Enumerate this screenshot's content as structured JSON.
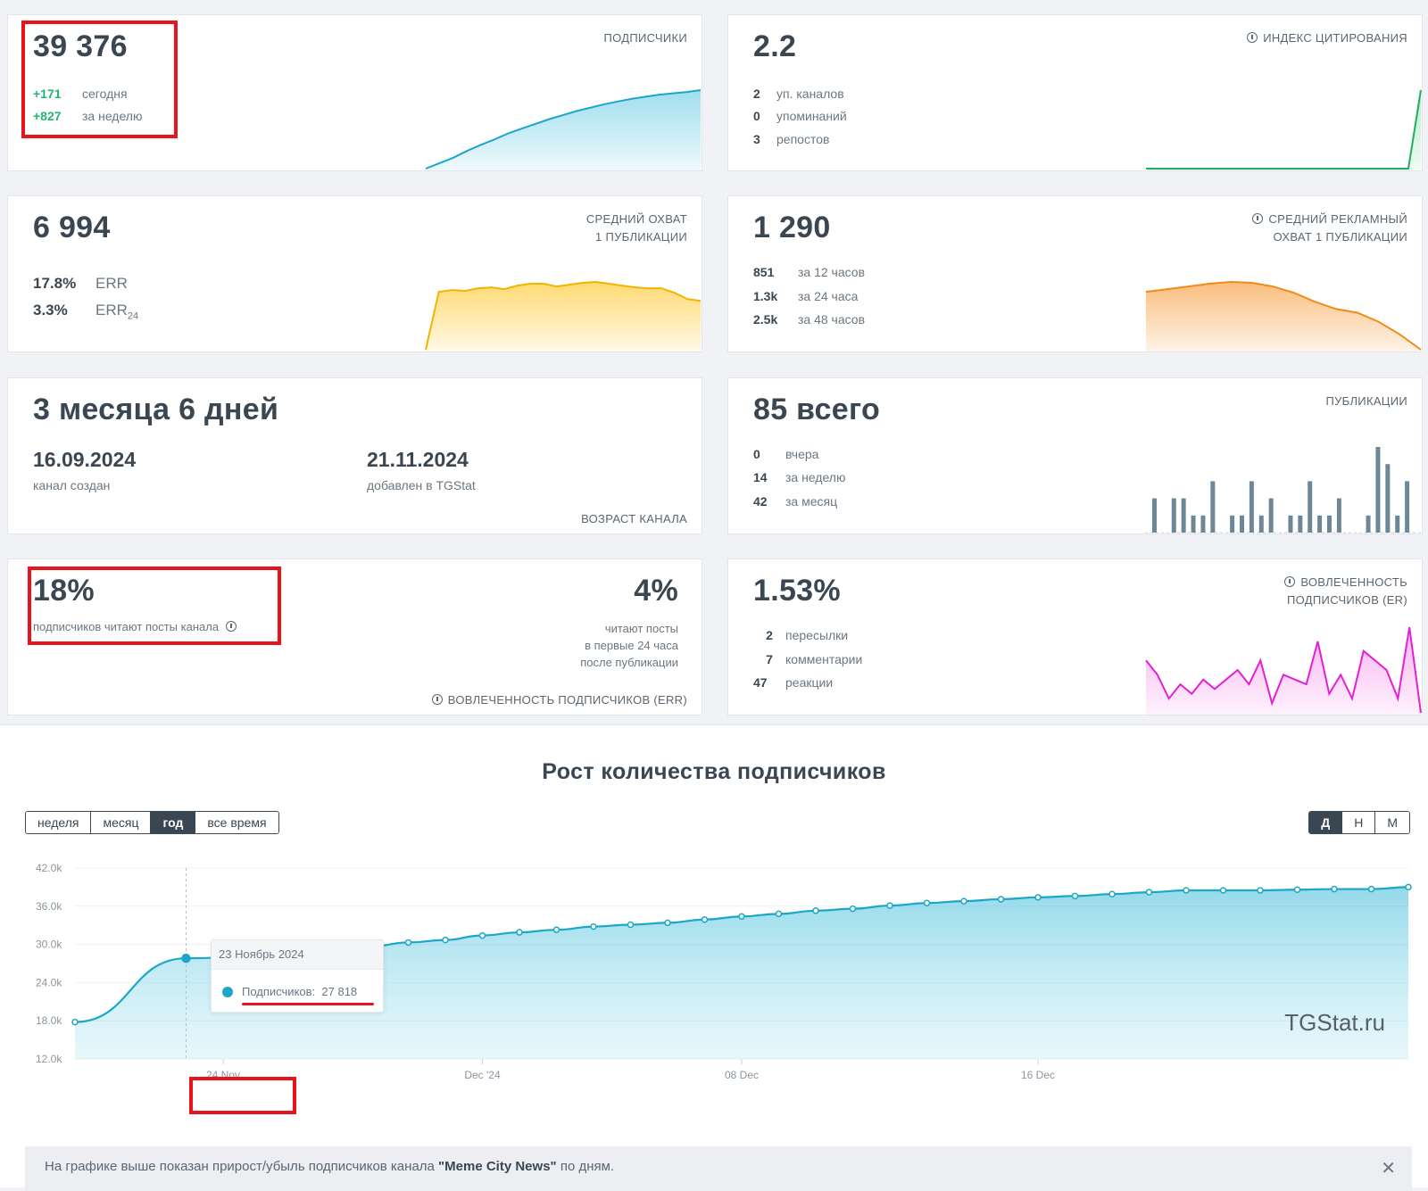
{
  "subscribers": {
    "total": "39 376",
    "caption": "ПОДПИСЧИКИ",
    "rows": [
      {
        "value": "+171",
        "label": "сегодня"
      },
      {
        "value": "+827",
        "label": "за неделю"
      }
    ]
  },
  "citation": {
    "value": "2.2",
    "caption": "ИНДЕКС ЦИТИРОВАНИЯ",
    "rows": [
      {
        "value": "2",
        "label": "уп. каналов"
      },
      {
        "value": "0",
        "label": "упоминаний"
      },
      {
        "value": "3",
        "label": "репостов"
      }
    ]
  },
  "reach": {
    "value": "6 994",
    "caption_line1": "СРЕДНИЙ ОХВАТ",
    "caption_line2": "1 ПУБЛИКАЦИИ",
    "rows": [
      {
        "value": "17.8%",
        "label": "ERR"
      },
      {
        "value": "3.3%",
        "label": "ERR",
        "sub": "24"
      }
    ]
  },
  "ad_reach": {
    "value": "1 290",
    "caption_line1": "СРЕДНИЙ РЕКЛАМНЫЙ",
    "caption_line2": "ОХВАТ 1 ПУБЛИКАЦИИ",
    "rows": [
      {
        "value": "851",
        "label": "за 12 часов"
      },
      {
        "value": "1.3k",
        "label": "за 24 часа"
      },
      {
        "value": "2.5k",
        "label": "за 48 часов"
      }
    ]
  },
  "age": {
    "value": "3 месяца 6 дней",
    "created_date": "16.09.2024",
    "created_label": "канал создан",
    "added_date": "21.11.2024",
    "added_label": "добавлен в TGStat",
    "caption": "ВОЗРАСТ КАНАЛА"
  },
  "posts": {
    "value": "85 всего",
    "caption": "ПУБЛИКАЦИИ",
    "rows": [
      {
        "value": "0",
        "label": "вчера"
      },
      {
        "value": "14",
        "label": "за неделю"
      },
      {
        "value": "42",
        "label": "за месяц"
      }
    ]
  },
  "read": {
    "value": "18%",
    "label": "подписчиков читают посты канала",
    "right_value": "4%",
    "right_line1": "читают посты",
    "right_line2": "в первые 24 часа",
    "right_line3": "после публикации",
    "caption": "ВОВЛЕЧЕННОСТЬ ПОДПИСЧИКОВ (ERR)"
  },
  "er": {
    "value": "1.53%",
    "caption_line1": "ВОВЛЕЧЕННОСТЬ",
    "caption_line2": "ПОДПИСЧИКОВ (ER)",
    "rows": [
      {
        "value": "2",
        "label": "пересылки"
      },
      {
        "value": "7",
        "label": "комментарии"
      },
      {
        "value": "47",
        "label": "реакции"
      }
    ]
  },
  "growth": {
    "title": "Рост количества подписчиков",
    "periods": [
      "неделя",
      "месяц",
      "год",
      "все время"
    ],
    "active_period": "год",
    "granularity": [
      "Д",
      "Н",
      "М"
    ],
    "active_granularity": "Д",
    "watermark": "TGStat.ru",
    "tooltip_date": "23 Ноябрь 2024",
    "tooltip_label": "Подписчиков:",
    "tooltip_value": "27 818",
    "note_prefix": "На графике выше показан прирост/убыль подписчиков канала ",
    "note_channel": "\"Meme City News\"",
    "note_suffix": " по дням.",
    "close_icon": "close-icon"
  },
  "chart_data": {
    "type": "area",
    "title": "Рост количества подписчиков",
    "xlabel": "",
    "ylabel": "",
    "y_ticks": [
      "12.0k",
      "18.0k",
      "24.0k",
      "30.0k",
      "36.0k",
      "42.0k"
    ],
    "x_ticks": [
      "24 Nov",
      "Dec '24",
      "08 Dec",
      "16 Dec"
    ],
    "ylim": [
      12000,
      42000
    ],
    "color": "#1aa7c8",
    "x": [
      "2024-11-20",
      "2024-11-23",
      "2024-11-26",
      "2024-11-27",
      "2024-11-28",
      "2024-11-29",
      "2024-11-30",
      "2024-12-01",
      "2024-12-02",
      "2024-12-03",
      "2024-12-04",
      "2024-12-05",
      "2024-12-06",
      "2024-12-07",
      "2024-12-08",
      "2024-12-09",
      "2024-12-10",
      "2024-12-11",
      "2024-12-12",
      "2024-12-13",
      "2024-12-14",
      "2024-12-15",
      "2024-12-16",
      "2024-12-17",
      "2024-12-18",
      "2024-12-19",
      "2024-12-20",
      "2024-12-21",
      "2024-12-22",
      "2024-12-23",
      "2024-12-24",
      "2024-12-25",
      "2024-12-26"
    ],
    "series": [
      {
        "values": [
          17800,
          27818,
          28800,
          29200,
          29700,
          30300,
          30700,
          31400,
          31900,
          32300,
          32800,
          33100,
          33400,
          33900,
          34400,
          34800,
          35300,
          35600,
          36100,
          36500,
          36800,
          37100,
          37400,
          37600,
          37900,
          38200,
          38500,
          38500,
          38500,
          38600,
          38700,
          38700,
          39000
        ]
      }
    ],
    "sparklines": {
      "subscribers": [
        27800,
        28600,
        29400,
        30400,
        31300,
        32100,
        33000,
        33700,
        34400,
        35100,
        35700,
        36300,
        36800,
        37300,
        37700,
        38100,
        38400,
        38700,
        38900,
        39100,
        39376
      ],
      "citation": [
        0,
        0,
        0,
        0,
        0,
        0,
        0,
        0,
        0,
        0,
        0,
        0,
        0,
        0,
        0,
        0,
        0,
        0,
        0,
        0,
        0,
        0,
        2.2
      ],
      "reach": [
        0,
        6400,
        6600,
        6500,
        6800,
        6900,
        6700,
        7100,
        7300,
        7300,
        7000,
        7200,
        7400,
        7500,
        7300,
        7100,
        6900,
        6800,
        6800,
        6300,
        5600,
        5400
      ],
      "ad_reach": [
        1290,
        1320,
        1350,
        1380,
        1400,
        1390,
        1350,
        1280,
        1180,
        1100,
        1060,
        960,
        820,
        650
      ],
      "posts": [
        2,
        0,
        2,
        2,
        1,
        1,
        3,
        0,
        1,
        1,
        3,
        1,
        2,
        0,
        1,
        1,
        3,
        1,
        1,
        2,
        0,
        0,
        1,
        5,
        4,
        1,
        3
      ],
      "er": [
        1.9,
        1.6,
        1.1,
        1.4,
        1.2,
        1.5,
        1.3,
        1.5,
        1.7,
        1.4,
        1.9,
        1.0,
        1.6,
        1.5,
        1.4,
        2.3,
        1.2,
        1.6,
        1.1,
        2.1,
        1.9,
        1.7,
        1.1,
        2.6,
        0.8
      ]
    }
  }
}
